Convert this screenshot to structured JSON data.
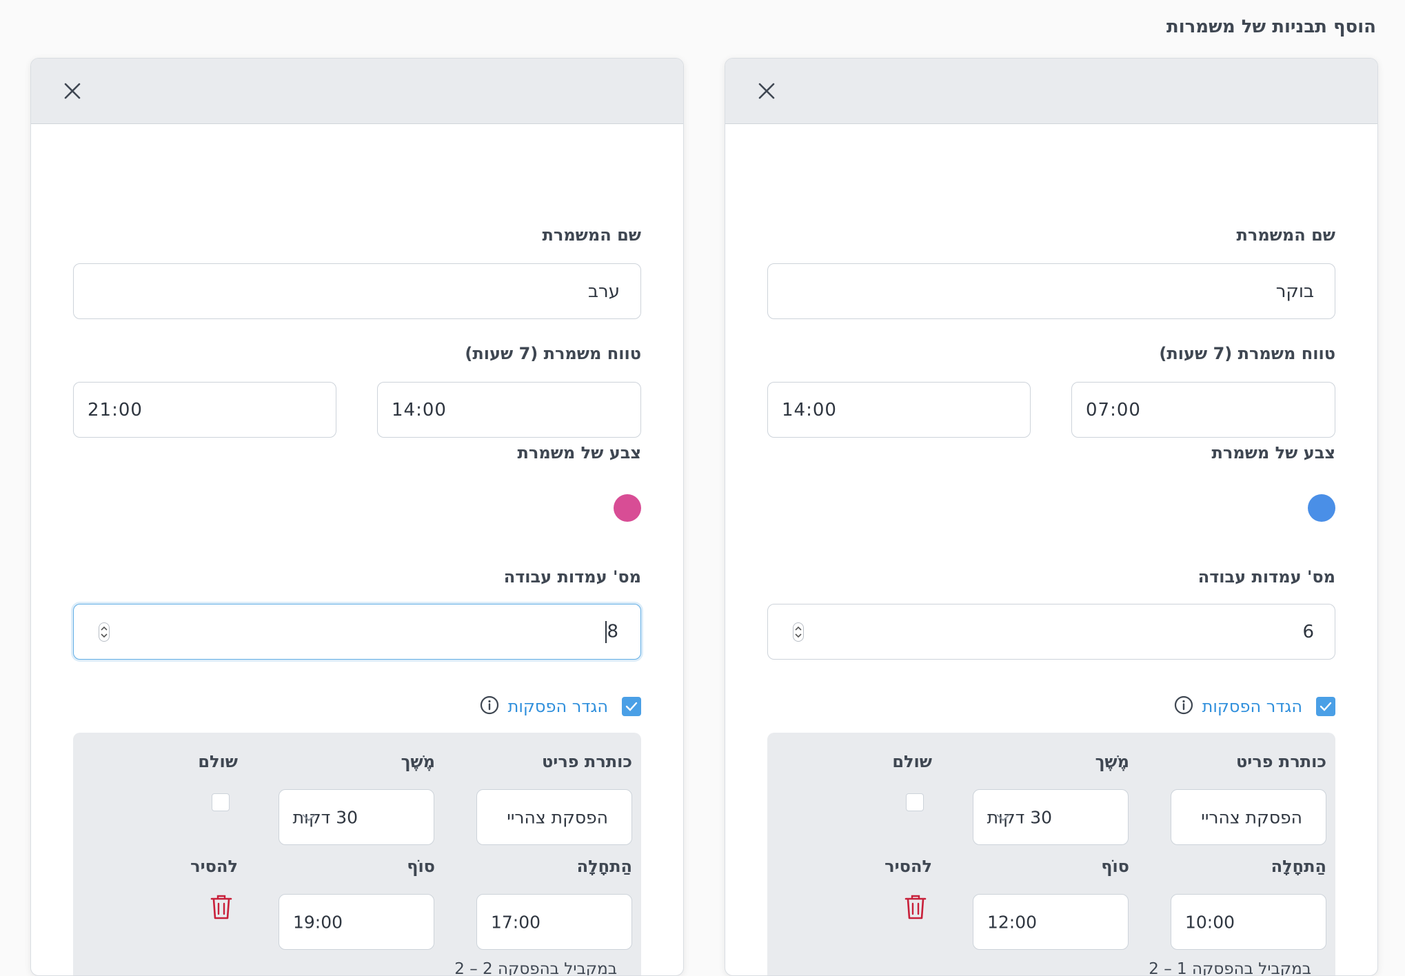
{
  "page": {
    "title": "הוסף תבניות של משמרות"
  },
  "colors": {
    "accent": "#4a9fe6",
    "link": "#2f8fdc",
    "danger": "#c8203a",
    "panel_bg": "#e9ebee"
  },
  "cards": [
    {
      "name_label": "שם המשמרת",
      "name_value": "בוקר",
      "range_label": "טווח משמרת (7 שעות)",
      "start_time": "07:00",
      "end_time": "14:00",
      "color_label": "צבע של משמרת",
      "color": "#4a8fe7",
      "stations_label": "מס' עמדות עבודה",
      "stations_value": "6",
      "breaks_label": "הגדר הפסקות",
      "break": {
        "title_label": "כותרת פריט",
        "title_value": "הפסקת צהריי",
        "duration_label": "מֶשֶׁך",
        "duration_value": "30 דקות",
        "paid_label": "שולם",
        "start_label": "הַתחָלָה",
        "start_value": "10:00",
        "end_label": "סוֹף",
        "end_value": "12:00",
        "remove_label": "להסיר",
        "parallel_note": "במקביל בהפסקה 1 – 2"
      }
    },
    {
      "name_label": "שם המשמרת",
      "name_value": "ערב",
      "range_label": "טווח משמרת (7 שעות)",
      "start_time": "14:00",
      "end_time": "21:00",
      "color_label": "צבע של משמרת",
      "color": "#d84d95",
      "stations_label": "מס' עמדות עבודה",
      "stations_value": "8",
      "breaks_label": "הגדר הפסקות",
      "break": {
        "title_label": "כותרת פריט",
        "title_value": "הפסקת צהריי",
        "duration_label": "מֶשֶׁך",
        "duration_value": "30 דקות",
        "paid_label": "שולם",
        "start_label": "הַתחָלָה",
        "start_value": "17:00",
        "end_label": "סוֹף",
        "end_value": "19:00",
        "remove_label": "להסיר",
        "parallel_note": "במקביל בהפסקה 2 – 2"
      }
    }
  ]
}
